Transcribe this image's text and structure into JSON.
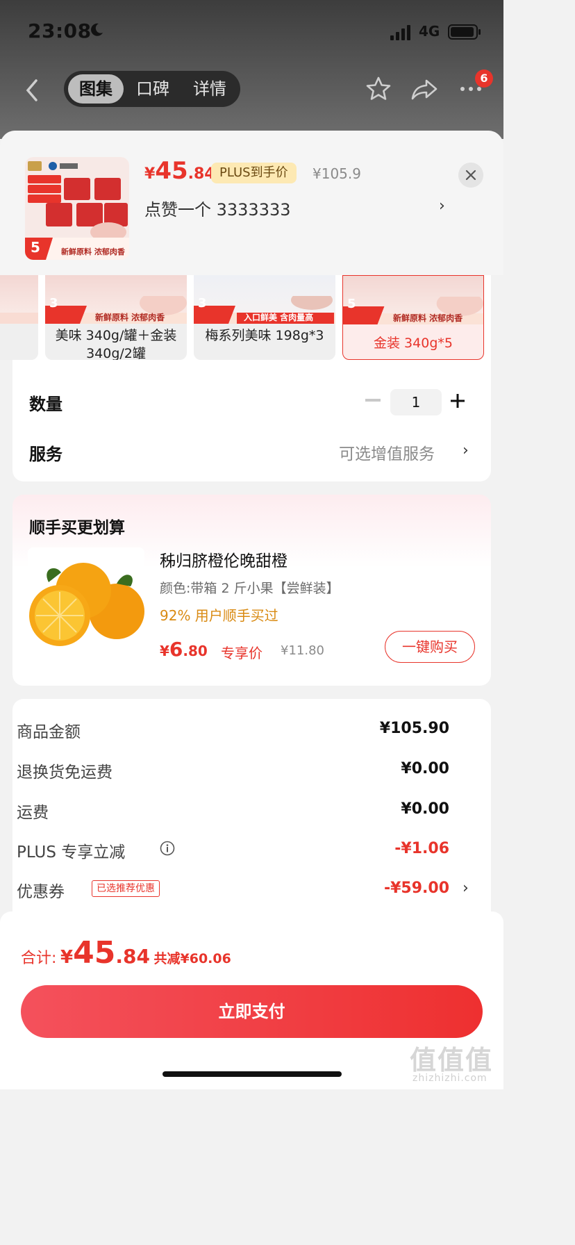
{
  "status": {
    "time": "23:08",
    "network": "4G"
  },
  "nav": {
    "tabs": [
      {
        "label": "图集",
        "active": true
      },
      {
        "label": "口碑",
        "active": false
      },
      {
        "label": "详情",
        "active": false
      }
    ],
    "more_badge": "6"
  },
  "product": {
    "price_symbol": "¥",
    "price_int": "45",
    "price_dec": ".84",
    "plus_tag": "PLUS到手价",
    "original_price": "¥105.9",
    "spec": "点赞一个  3333333",
    "thumb_count": "5",
    "thumb_caption": "新鲜原料 浓郁肉香"
  },
  "variants": [
    {
      "label": "",
      "selected": false,
      "count": "",
      "caption": ""
    },
    {
      "label": "美味 340g/罐＋金装 340g/2罐",
      "selected": false,
      "count": "3",
      "caption": "新鲜原料 浓郁肉香"
    },
    {
      "label": "梅系列美味 198g*3",
      "selected": false,
      "count": "3",
      "caption": "入口鲜美 含肉量高"
    },
    {
      "label": "金装 340g*5",
      "selected": true,
      "count": "5",
      "caption": "新鲜原料 浓郁肉香"
    }
  ],
  "quantity": {
    "label": "数量",
    "value": "1"
  },
  "service": {
    "label": "服务",
    "value": "可选增值服务"
  },
  "bundle": {
    "title": "顺手买更划算",
    "name": "秭归脐橙伦晚甜橙",
    "spec": "颜色:带箱 2 斤小果【尝鲜装】",
    "rate": "92% 用户顺手买过",
    "price_symbol": "¥",
    "price_int": "6",
    "price_dec": ".80",
    "exclusive": "专享价",
    "original": "¥11.80",
    "button": "一键购买"
  },
  "summary": {
    "rows": [
      {
        "label": "商品金额",
        "value": "¥105.90",
        "red": false
      },
      {
        "label": "退换货免运费",
        "value": "¥0.00",
        "red": false
      },
      {
        "label": "运费",
        "value": "¥0.00",
        "red": false
      },
      {
        "label": "PLUS 专享立减",
        "value": "-¥1.06",
        "red": true
      },
      {
        "label": "优惠券",
        "value": "-¥59.00",
        "red": true
      }
    ],
    "coupon_tag": "已选推荐优惠"
  },
  "footer": {
    "total_label": "合计:",
    "total_symbol": "¥",
    "total_int": "45",
    "total_dec": ".84",
    "saved": "共减¥60.06",
    "pay_button": "立即支付",
    "watermark": "值值值",
    "watermark_sub": "zhizhizhi.com"
  },
  "colors": {
    "accent": "#e8342b",
    "plus_tag_bg": "#fde9b3",
    "rate": "#d98a12"
  },
  "icons": [
    "back-icon",
    "star-icon",
    "share-icon",
    "more-icon",
    "close-icon",
    "chevron-right-icon",
    "info-icon",
    "plus-icon",
    "minus-icon",
    "moon-icon",
    "signal-icon",
    "battery-icon"
  ]
}
